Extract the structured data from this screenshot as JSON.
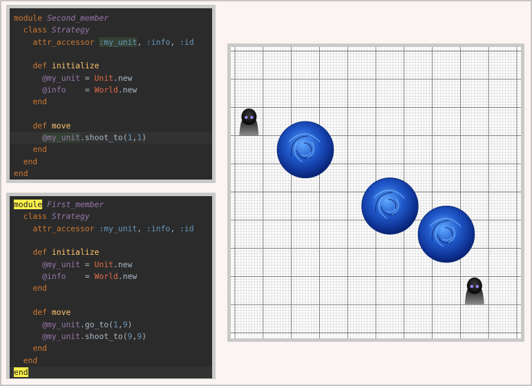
{
  "colors": {
    "page_background": "#fcf4f2",
    "editor_background": "#2b2b2b",
    "keyword": "#cc7832",
    "module_name": "#9876aa",
    "method_name": "#ffc66d",
    "symbol": "#6897bb",
    "instance_variable": "#9876aa",
    "constant": "#e06c4a",
    "orb": "#1f57c8"
  },
  "second_member_code": {
    "lines": [
      {
        "tokens": [
          {
            "t": "module",
            "c": "kw"
          },
          {
            "t": " "
          },
          {
            "t": "Second_member",
            "c": "mod"
          }
        ]
      },
      {
        "tokens": [
          {
            "t": "  "
          },
          {
            "t": "class",
            "c": "kw"
          },
          {
            "t": " "
          },
          {
            "t": "Strategy",
            "c": "mod"
          }
        ]
      },
      {
        "tokens": [
          {
            "t": "    "
          },
          {
            "t": "attr_accessor",
            "c": "kw"
          },
          {
            "t": " "
          },
          {
            "t": ":my_unit",
            "c": "sym tagbg"
          },
          {
            "t": ", "
          },
          {
            "t": ":info",
            "c": "sym"
          },
          {
            "t": ", "
          },
          {
            "t": ":id",
            "c": "sym"
          }
        ]
      },
      {
        "tokens": [
          {
            "t": ""
          }
        ]
      },
      {
        "tokens": [
          {
            "t": "    "
          },
          {
            "t": "def",
            "c": "kw"
          },
          {
            "t": " "
          },
          {
            "t": "initialize",
            "c": "fn"
          }
        ]
      },
      {
        "tokens": [
          {
            "t": "      "
          },
          {
            "t": "@my_unit",
            "c": "ivar"
          },
          {
            "t": " = "
          },
          {
            "t": "Unit",
            "c": "const"
          },
          {
            "t": ".new"
          }
        ]
      },
      {
        "tokens": [
          {
            "t": "      "
          },
          {
            "t": "@info",
            "c": "ivar"
          },
          {
            "t": "    = "
          },
          {
            "t": "World",
            "c": "const"
          },
          {
            "t": ".new"
          }
        ]
      },
      {
        "tokens": [
          {
            "t": "    "
          },
          {
            "t": "end",
            "c": "kw"
          }
        ]
      },
      {
        "tokens": [
          {
            "t": ""
          }
        ]
      },
      {
        "tokens": [
          {
            "t": "    "
          },
          {
            "t": "def",
            "c": "kw"
          },
          {
            "t": " "
          },
          {
            "t": "move",
            "c": "fn"
          }
        ]
      },
      {
        "tokens": [
          {
            "t": "      "
          },
          {
            "t": "@my_unit",
            "c": "ivar tagbg"
          },
          {
            "t": ".shoot_to("
          },
          {
            "t": "1",
            "c": "num"
          },
          {
            "t": ","
          },
          {
            "t": "1",
            "c": "num"
          },
          {
            "t": ")"
          }
        ],
        "hl": true
      },
      {
        "tokens": [
          {
            "t": "    "
          },
          {
            "t": "end",
            "c": "kw"
          }
        ]
      },
      {
        "tokens": [
          {
            "t": "  "
          },
          {
            "t": "end",
            "c": "kw"
          }
        ]
      },
      {
        "tokens": [
          {
            "t": "end",
            "c": "kw"
          }
        ]
      }
    ]
  },
  "first_member_code": {
    "lines": [
      {
        "tokens": [
          {
            "t": "module",
            "c": "yel"
          },
          {
            "t": " "
          },
          {
            "t": "First_member",
            "c": "mod"
          }
        ]
      },
      {
        "tokens": [
          {
            "t": "  "
          },
          {
            "t": "class",
            "c": "kw"
          },
          {
            "t": " "
          },
          {
            "t": "Strategy",
            "c": "mod"
          }
        ]
      },
      {
        "tokens": [
          {
            "t": "    "
          },
          {
            "t": "attr_accessor",
            "c": "kw"
          },
          {
            "t": " "
          },
          {
            "t": ":my_unit",
            "c": "sym"
          },
          {
            "t": ", "
          },
          {
            "t": ":info",
            "c": "sym"
          },
          {
            "t": ", "
          },
          {
            "t": ":id",
            "c": "sym"
          }
        ]
      },
      {
        "tokens": [
          {
            "t": ""
          }
        ]
      },
      {
        "tokens": [
          {
            "t": "    "
          },
          {
            "t": "def",
            "c": "kw"
          },
          {
            "t": " "
          },
          {
            "t": "initialize",
            "c": "fn"
          }
        ]
      },
      {
        "tokens": [
          {
            "t": "      "
          },
          {
            "t": "@my_unit",
            "c": "ivar"
          },
          {
            "t": " = "
          },
          {
            "t": "Unit",
            "c": "const"
          },
          {
            "t": ".new"
          }
        ]
      },
      {
        "tokens": [
          {
            "t": "      "
          },
          {
            "t": "@info",
            "c": "ivar"
          },
          {
            "t": "    = "
          },
          {
            "t": "World",
            "c": "const"
          },
          {
            "t": ".new"
          }
        ]
      },
      {
        "tokens": [
          {
            "t": "    "
          },
          {
            "t": "end",
            "c": "kw"
          }
        ]
      },
      {
        "tokens": [
          {
            "t": ""
          }
        ]
      },
      {
        "tokens": [
          {
            "t": "    "
          },
          {
            "t": "def",
            "c": "kw"
          },
          {
            "t": " "
          },
          {
            "t": "move",
            "c": "fn"
          }
        ]
      },
      {
        "tokens": [
          {
            "t": "      "
          },
          {
            "t": "@my_unit",
            "c": "ivar"
          },
          {
            "t": ".go_to("
          },
          {
            "t": "1",
            "c": "num"
          },
          {
            "t": ","
          },
          {
            "t": "9",
            "c": "num"
          },
          {
            "t": ")"
          }
        ]
      },
      {
        "tokens": [
          {
            "t": "      "
          },
          {
            "t": "@my_unit",
            "c": "ivar"
          },
          {
            "t": ".shoot_to("
          },
          {
            "t": "9",
            "c": "num"
          },
          {
            "t": ","
          },
          {
            "t": "9",
            "c": "num"
          },
          {
            "t": ")"
          }
        ]
      },
      {
        "tokens": [
          {
            "t": "    "
          },
          {
            "t": "end",
            "c": "kw"
          }
        ]
      },
      {
        "tokens": [
          {
            "t": "  "
          },
          {
            "t": "end",
            "c": "kw"
          }
        ]
      },
      {
        "tokens": [
          {
            "t": "end",
            "c": "yel"
          }
        ],
        "hl": true
      }
    ]
  },
  "game_board": {
    "grid_cells": 10,
    "units": [
      {
        "icon": "hooded-unit-icon",
        "col": 1,
        "row": 3
      },
      {
        "icon": "hooded-unit-icon",
        "col": 9,
        "row": 9
      }
    ],
    "orbs": [
      {
        "icon": "energy-orb-icon",
        "col": 3,
        "row": 4
      },
      {
        "icon": "energy-orb-icon",
        "col": 6,
        "row": 6
      },
      {
        "icon": "energy-orb-icon",
        "col": 8,
        "row": 7
      }
    ]
  }
}
